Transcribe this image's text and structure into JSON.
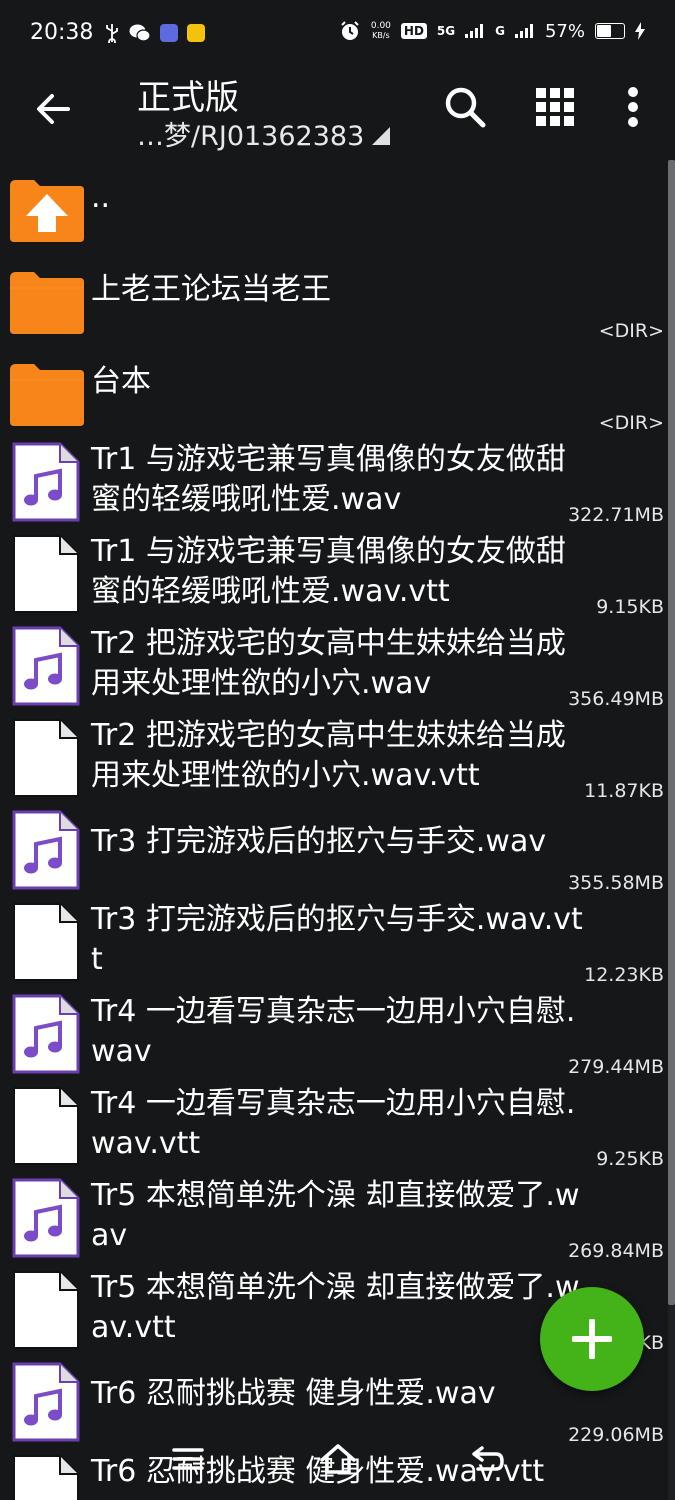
{
  "status_bar": {
    "time": "20:38",
    "speed_value": "0.00",
    "speed_unit": "KB/s",
    "hd_label": "HD",
    "hd_sub": "1",
    "net_5g": "5G",
    "net_g": "G",
    "battery": "57%",
    "battery_level": 0.57,
    "left_icons": [
      "usb-icon",
      "wechat-icon",
      "app-icon",
      "mail-icon"
    ],
    "right_icons": [
      "alarm-icon",
      "signal-icon",
      "battery-icon",
      "charging-icon"
    ]
  },
  "toolbar": {
    "title": "正式版",
    "path": "…梦/RJ01362383"
  },
  "colors": {
    "background": "#161719",
    "folder": "#f7851a",
    "audio_icon_border": "#6a3fb0",
    "audio_note": "#7a4cc8",
    "fab": "#44b219"
  },
  "files": [
    {
      "type": "parent",
      "name": "..",
      "meta": ""
    },
    {
      "type": "folder",
      "name": "上老王论坛当老王",
      "meta": "<DIR>"
    },
    {
      "type": "folder",
      "name": "台本",
      "meta": "<DIR>"
    },
    {
      "type": "audio",
      "name": "Tr1 与游戏宅兼写真偶像的女友做甜蜜的轻缓哦吼性爱.wav",
      "meta": "322.71MB"
    },
    {
      "type": "text",
      "name": "Tr1 与游戏宅兼写真偶像的女友做甜蜜的轻缓哦吼性爱.wav.vtt",
      "meta": "9.15KB"
    },
    {
      "type": "audio",
      "name": "Tr2 把游戏宅的女高中生妹妹给当成用来处理性欲的小穴.wav",
      "meta": "356.49MB"
    },
    {
      "type": "text",
      "name": "Tr2 把游戏宅的女高中生妹妹给当成用来处理性欲的小穴.wav.vtt",
      "meta": "11.87KB"
    },
    {
      "type": "audio",
      "name": "Tr3 打完游戏后的抠穴与手交.wav",
      "meta": "355.58MB"
    },
    {
      "type": "text",
      "name": "Tr3 打完游戏后的抠穴与手交.wav.vtt",
      "meta": "12.23KB"
    },
    {
      "type": "audio",
      "name": "Tr4 一边看写真杂志一边用小穴自慰.wav",
      "meta": "279.44MB"
    },
    {
      "type": "text",
      "name": "Tr4 一边看写真杂志一边用小穴自慰.wav.vtt",
      "meta": "9.25KB"
    },
    {
      "type": "audio",
      "name": "Tr5 本想简单洗个澡 却直接做爱了.wav",
      "meta": "269.84MB"
    },
    {
      "type": "text",
      "name": "Tr5 本想简单洗个澡 却直接做爱了.wav.vtt",
      "meta": "KB"
    },
    {
      "type": "audio",
      "name": "Tr6 忍耐挑战赛 健身性爱.wav",
      "meta": "229.06MB"
    },
    {
      "type": "text",
      "name": "Tr6 忍耐挑战赛 健身性爱.wav.vtt",
      "meta": ""
    }
  ]
}
